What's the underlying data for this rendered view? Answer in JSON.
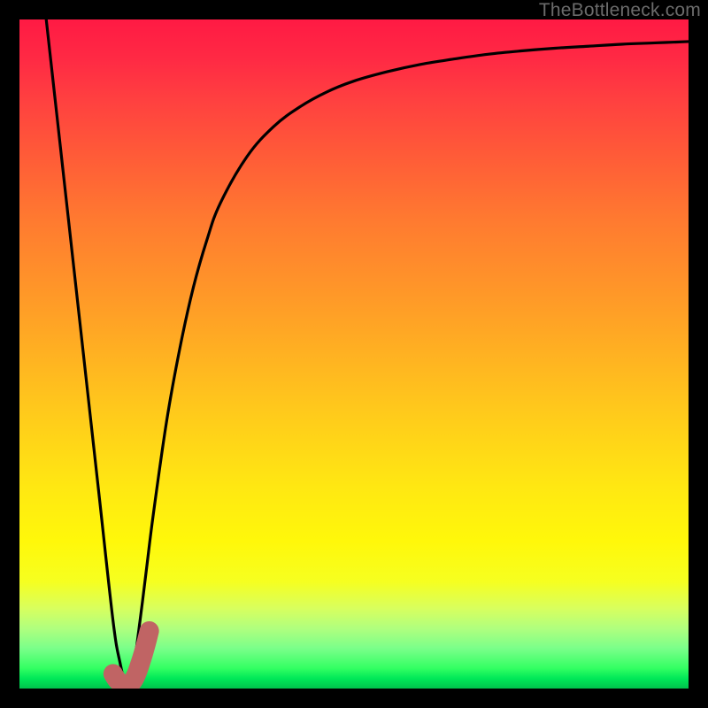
{
  "watermark": "TheBottleneck.com",
  "colors": {
    "frame": "#000000",
    "curve": "#000000",
    "marker_stroke": "#c06464",
    "marker_fill": "#c06464"
  },
  "chart_data": {
    "type": "line",
    "title": "",
    "xlabel": "",
    "ylabel": "",
    "xlim": [
      0,
      100
    ],
    "ylim": [
      0,
      100
    ],
    "grid": false,
    "legend": false,
    "series": [
      {
        "name": "bottleneck-curve",
        "x": [
          4.0,
          6.0,
          8.0,
          10.0,
          12.0,
          14.0,
          15.0,
          16.0,
          17.0,
          18.0,
          19.0,
          20.0,
          22.0,
          24.0,
          26.0,
          28.0,
          30.0,
          34.0,
          38.0,
          42.0,
          46.0,
          50.0,
          55.0,
          60.0,
          65.0,
          70.0,
          75.0,
          80.0,
          85.0,
          90.0,
          95.0,
          100.0
        ],
        "values": [
          100.0,
          82.0,
          64.0,
          46.0,
          28.0,
          10.0,
          4.0,
          0.5,
          3.0,
          10.0,
          18.0,
          26.0,
          40.0,
          51.0,
          60.0,
          67.0,
          72.5,
          79.5,
          84.0,
          87.0,
          89.2,
          90.8,
          92.2,
          93.3,
          94.1,
          94.8,
          95.3,
          95.7,
          96.0,
          96.3,
          96.5,
          96.7
        ]
      },
      {
        "name": "highlight-marker",
        "x": [
          14.0,
          14.5,
          15.0,
          15.5,
          16.0,
          16.5,
          17.0,
          17.5,
          18.0,
          18.5,
          19.0,
          19.4
        ],
        "values": [
          2.2,
          1.4,
          0.9,
          0.6,
          0.5,
          0.7,
          1.2,
          2.2,
          3.6,
          5.2,
          7.0,
          8.6
        ]
      }
    ],
    "annotations": []
  }
}
